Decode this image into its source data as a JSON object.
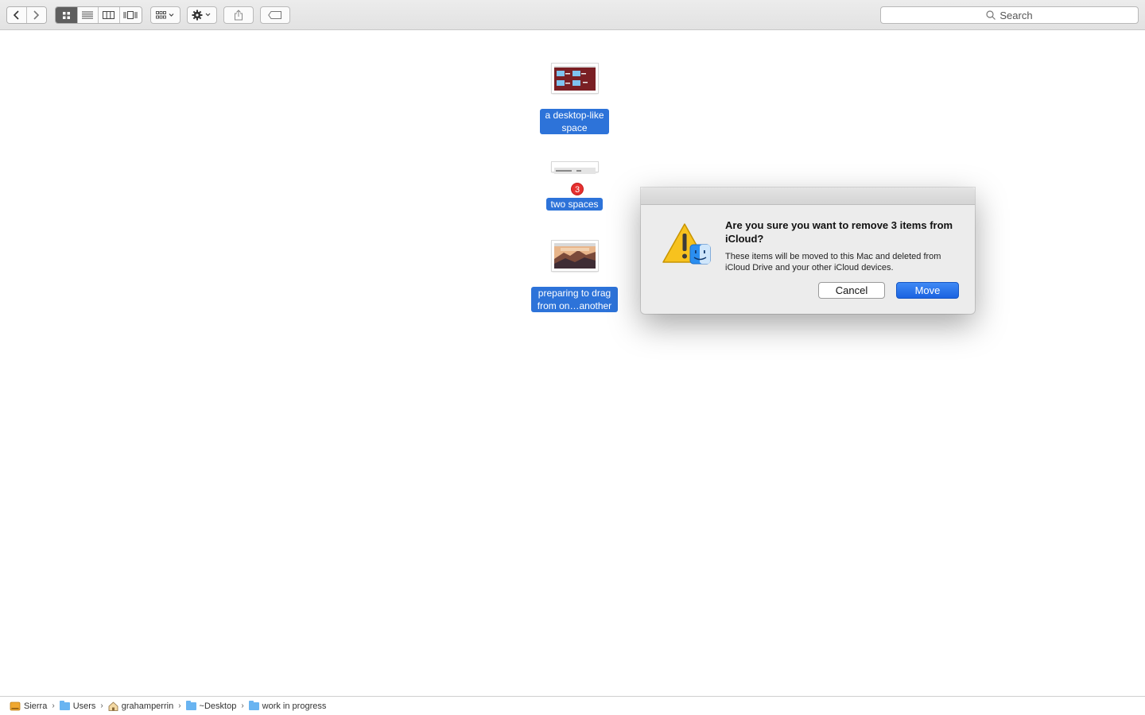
{
  "search": {
    "placeholder": "Search"
  },
  "items": [
    {
      "label": "a desktop-like space"
    },
    {
      "label": "two spaces",
      "badge": "3"
    },
    {
      "label": "preparing to drag from on…another"
    }
  ],
  "dialog": {
    "title": "Are you sure you want to remove 3 items from iCloud?",
    "message": "These items will be moved to this Mac and deleted from iCloud Drive and your other iCloud devices.",
    "cancel_label": "Cancel",
    "move_label": "Move"
  },
  "pathbar": {
    "crumbs": [
      "Sierra",
      "Users",
      "grahamperrin",
      "~Desktop",
      "work in progress"
    ]
  },
  "colors": {
    "selection": "#2d73d9",
    "primary_button": "#1a63e0",
    "badge": "#e6302f"
  }
}
